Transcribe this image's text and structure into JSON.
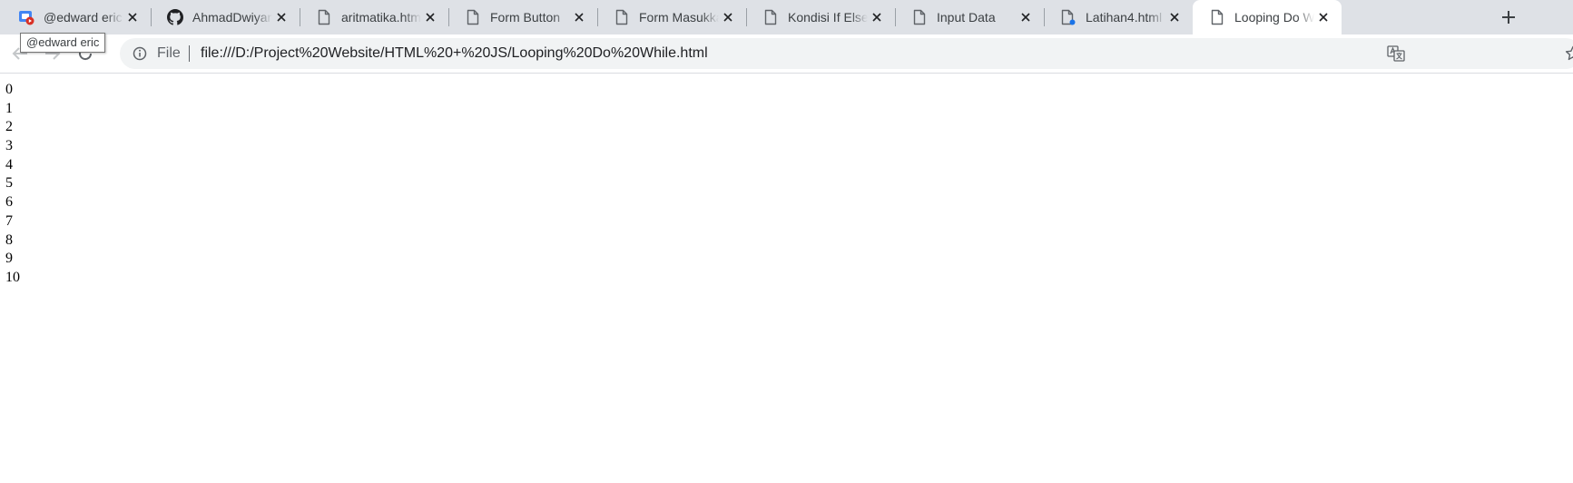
{
  "tabs": [
    {
      "title": "@edward eric",
      "icon": "youtube-studio-icon",
      "active": false
    },
    {
      "title": "AhmadDwiyan/",
      "icon": "github-icon",
      "active": false
    },
    {
      "title": "aritmatika.html",
      "icon": "file-icon",
      "active": false
    },
    {
      "title": "Form Button",
      "icon": "file-icon",
      "active": false
    },
    {
      "title": "Form Masukkan",
      "icon": "file-icon",
      "active": false
    },
    {
      "title": "Kondisi If Else",
      "icon": "file-icon",
      "active": false
    },
    {
      "title": "Input Data",
      "icon": "file-icon",
      "active": false
    },
    {
      "title": "Latihan4.html",
      "icon": "file-icon",
      "active": false
    },
    {
      "title": "Looping Do While",
      "icon": "file-icon",
      "active": true
    }
  ],
  "tooltip": {
    "text": "@edward eric"
  },
  "address_bar": {
    "scheme_label": "File",
    "url": "file:///D:/Project%20Website/HTML%20+%20JS/Looping%20Do%20While.html"
  },
  "page": {
    "lines": [
      "0",
      "1",
      "2",
      "3",
      "4",
      "5",
      "6",
      "7",
      "8",
      "9",
      "10"
    ]
  },
  "colors": {
    "tabstrip_bg": "#dee1e6",
    "active_tab_bg": "#ffffff",
    "omnibox_bg": "#f1f3f4",
    "icon_gray": "#5f6368",
    "notification_dot": "#1a73e8"
  }
}
